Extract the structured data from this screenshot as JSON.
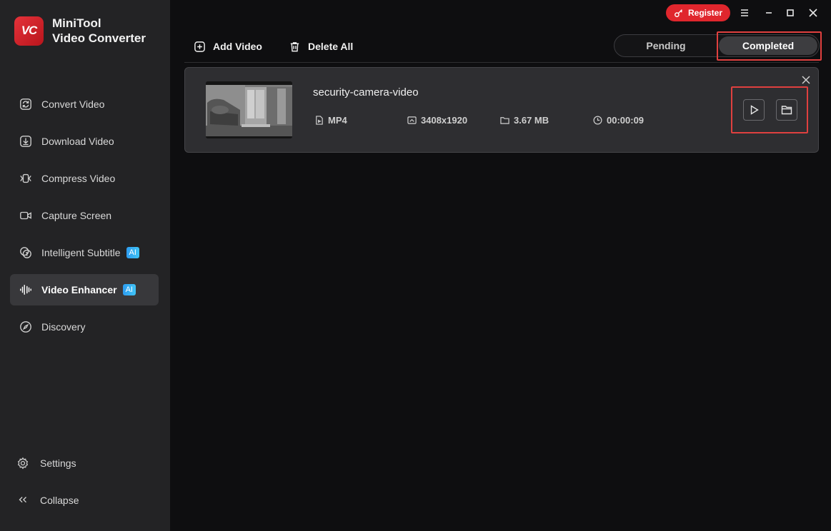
{
  "app": {
    "name_line1": "MiniTool",
    "name_line2": "Video Converter",
    "logo_text": "VC"
  },
  "sidebar": {
    "items": [
      {
        "label": "Convert Video",
        "icon": "convert-icon"
      },
      {
        "label": "Download Video",
        "icon": "download-icon"
      },
      {
        "label": "Compress Video",
        "icon": "compress-icon"
      },
      {
        "label": "Capture Screen",
        "icon": "camera-icon"
      },
      {
        "label": "Intelligent Subtitle",
        "icon": "subtitle-icon",
        "badge": "AI"
      },
      {
        "label": "Video Enhancer",
        "icon": "waveform-icon",
        "badge": "AI",
        "active": true
      },
      {
        "label": "Discovery",
        "icon": "compass-icon"
      }
    ],
    "settings_label": "Settings",
    "collapse_label": "Collapse"
  },
  "topbar": {
    "register_label": "Register"
  },
  "toolbar": {
    "add_video_label": "Add Video",
    "delete_all_label": "Delete All"
  },
  "tabs": {
    "pending_label": "Pending",
    "completed_label": "Completed",
    "selected": "Completed"
  },
  "video": {
    "title": "security-camera-video",
    "format": "MP4",
    "resolution": "3408x1920",
    "size": "3.67 MB",
    "duration": "00:00:09"
  },
  "colors": {
    "accent_red": "#e0262d",
    "highlight": "#e0403f",
    "ai_badge": "#2d9cf0",
    "sidebar_bg": "#232325",
    "main_bg": "#0e0e10"
  }
}
